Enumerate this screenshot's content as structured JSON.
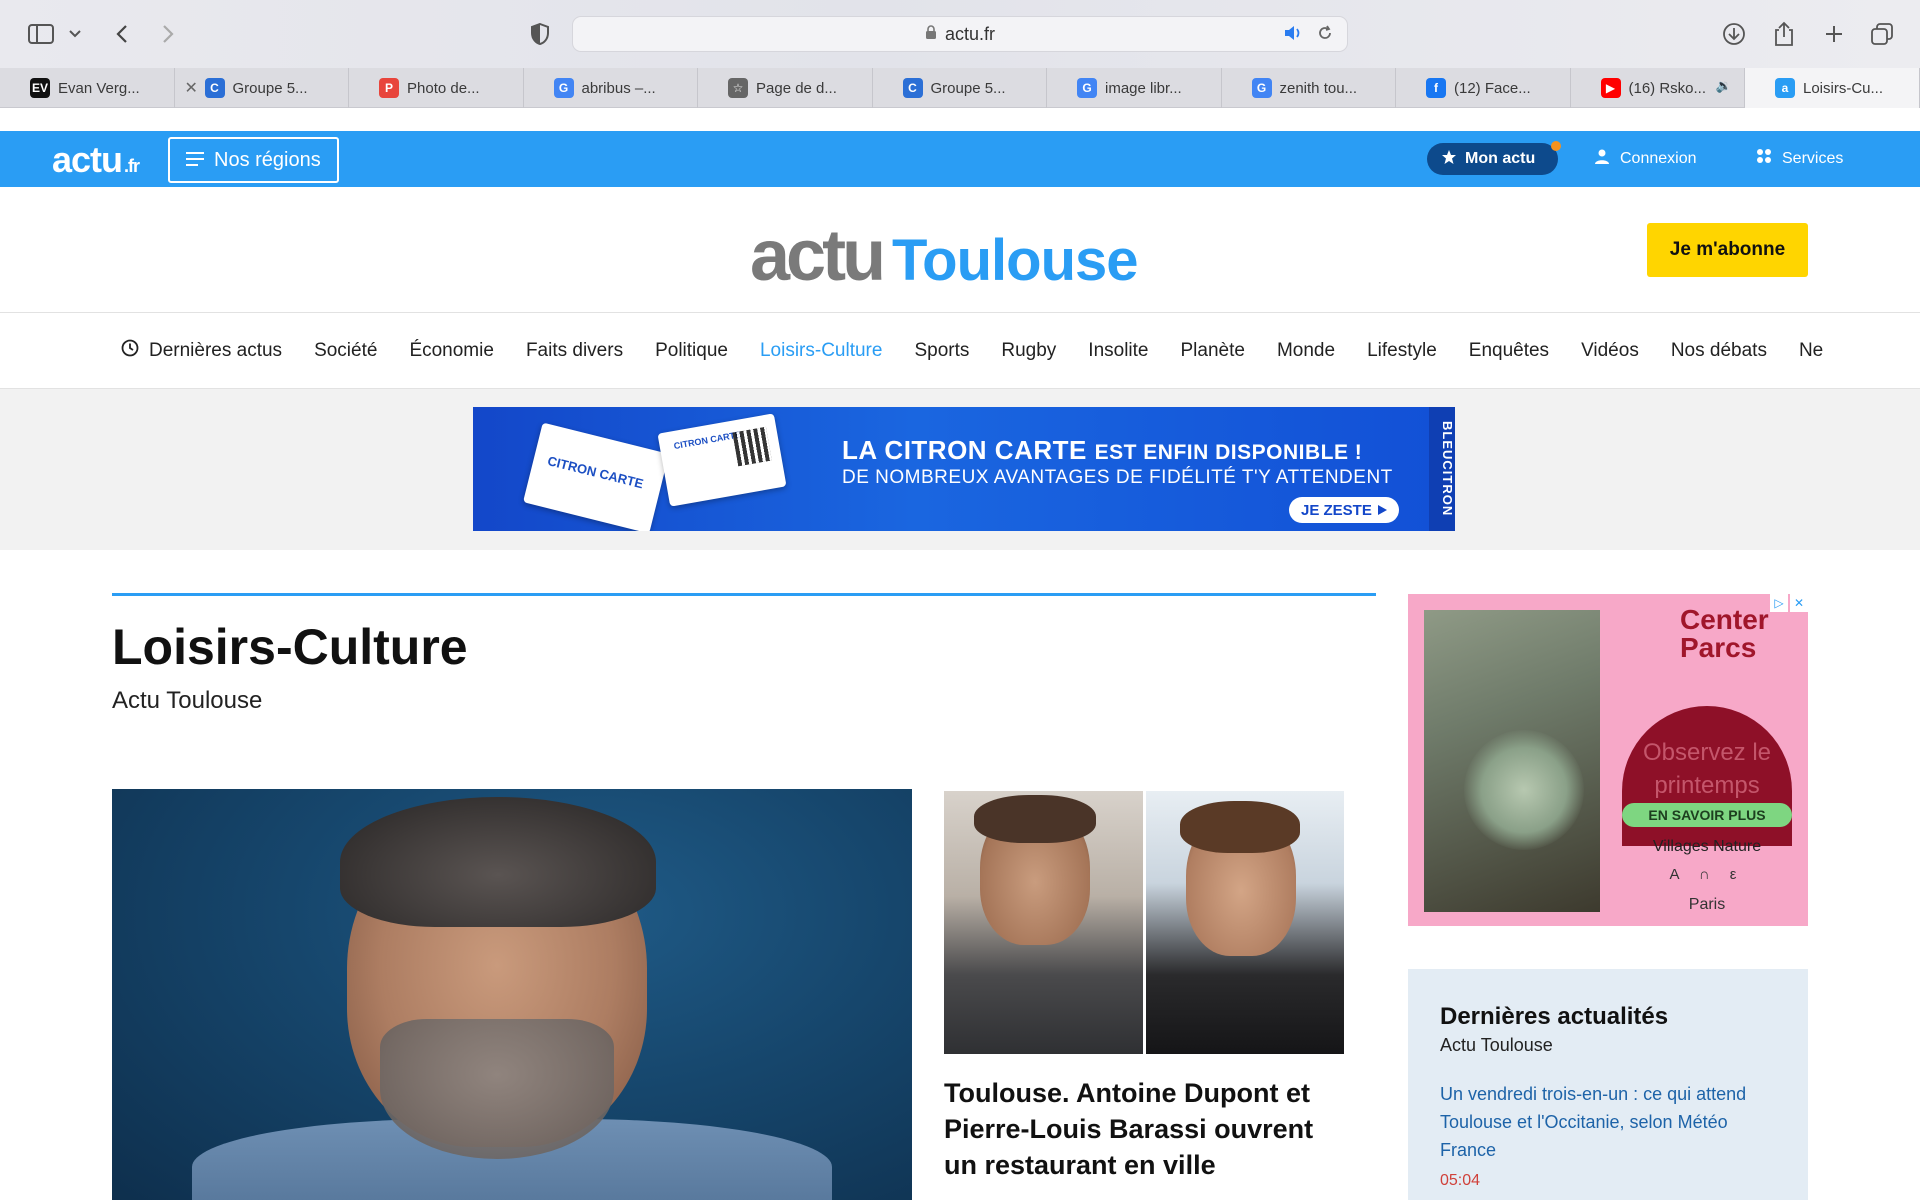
{
  "browser": {
    "url": "actu.fr",
    "tabs": [
      {
        "label": "Evan Verg...",
        "favicon": "EV",
        "color": "#111111"
      },
      {
        "label": "Groupe 5...",
        "favicon": "C",
        "color": "#2b6fd6",
        "close": true
      },
      {
        "label": "Photo de...",
        "favicon": "P",
        "color": "#e8453c"
      },
      {
        "label": "abribus –...",
        "favicon": "G",
        "color": "#4285f4"
      },
      {
        "label": "Page de d...",
        "favicon": "☆",
        "color": "#666666"
      },
      {
        "label": "Groupe 5...",
        "favicon": "C",
        "color": "#2b6fd6"
      },
      {
        "label": "image libr...",
        "favicon": "G",
        "color": "#4285f4"
      },
      {
        "label": "zenith tou...",
        "favicon": "G",
        "color": "#4285f4"
      },
      {
        "label": "(12) Face...",
        "favicon": "f",
        "color": "#1877f2"
      },
      {
        "label": "(16) Rsko...",
        "favicon": "▶",
        "color": "#ff0000",
        "audio": true
      },
      {
        "label": "Loisirs-Cu...",
        "favicon": "a",
        "color": "#2a9df4",
        "active": true
      }
    ]
  },
  "site_bar": {
    "logo": "actu",
    "logo_suffix": ".fr",
    "regions": "Nos régions",
    "mon_actu": "Mon actu",
    "login": "Connexion",
    "services": "Services"
  },
  "masthead": {
    "brand": "actu",
    "city": "Toulouse",
    "subscribe": "Je m'abonne"
  },
  "categories": [
    {
      "label": "Dernières actus",
      "icon": "clock-icon"
    },
    {
      "label": "Société"
    },
    {
      "label": "Économie"
    },
    {
      "label": "Faits divers"
    },
    {
      "label": "Politique"
    },
    {
      "label": "Loisirs-Culture",
      "active": true
    },
    {
      "label": "Sports"
    },
    {
      "label": "Rugby"
    },
    {
      "label": "Insolite"
    },
    {
      "label": "Planète"
    },
    {
      "label": "Monde"
    },
    {
      "label": "Lifestyle"
    },
    {
      "label": "Enquêtes"
    },
    {
      "label": "Vidéos"
    },
    {
      "label": "Nos débats"
    },
    {
      "label": "Ne"
    }
  ],
  "banner_ad": {
    "card1": "CITRON CARTE",
    "card2": "CITRON CARTE",
    "title_strong": "LA CITRON CARTE",
    "title_rest": "EST ENFIN DISPONIBLE !",
    "subtitle": "DE NOMBREUX AVANTAGES DE FIDÉLITÉ T'Y ATTENDENT",
    "cta": "JE ZESTE",
    "brand": "BLEUCITRON"
  },
  "page": {
    "title": "Loisirs-Culture",
    "subtitle": "Actu Toulouse"
  },
  "second_article": {
    "title": "Toulouse. Antoine Dupont et Pierre-Louis Barassi ouvrent un restaurant en ville"
  },
  "side_ad": {
    "brand_line1": "Center",
    "brand_line2": "Parcs",
    "headline": "Observez le printemps",
    "cta": "EN SAVOIR PLUS",
    "tagline": "Villages Nature",
    "place": "Paris"
  },
  "latest": {
    "title": "Dernières actualités",
    "subtitle": "Actu Toulouse",
    "items": [
      {
        "text": "Un vendredi trois-en-un : ce qui attend Toulouse et l'Occitanie, selon Météo France",
        "time": "05:04"
      }
    ]
  },
  "colors": {
    "brand_blue": "#2a9df4",
    "subscribe_yellow": "#ffd500",
    "mon_actu_navy": "#0d4a8c"
  }
}
